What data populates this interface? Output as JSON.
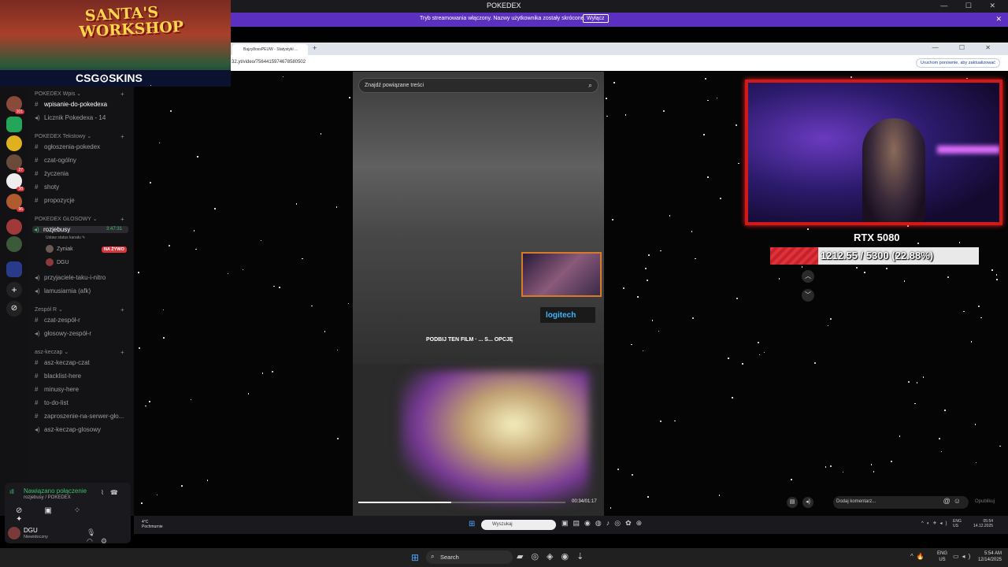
{
  "app": {
    "title": "POKEDEX",
    "window_controls": "— ☐ ✕"
  },
  "stream_notice": {
    "message": "Tryb streamowania włączony. Nazwy użytkownika zostały skrócone.",
    "button": "Wyłącz",
    "close": "✕"
  },
  "banner": {
    "title_line1": "SANTA'S",
    "title_line2": "WORKSHOP",
    "brand": "CSG⊙SKINS"
  },
  "browser": {
    "tab_title": "Bajzy8ossPEUW - Statystyki ...",
    "new_tab": "+",
    "url": "32.yt/video/7564415974678580502",
    "update_button": "Uruchom ponownie, aby zaktualizować"
  },
  "servers": {
    "badges": [
      "101",
      "27",
      "38",
      "96"
    ]
  },
  "channels": {
    "categories": [
      {
        "label": "POKEDEX Wpis ⌄",
        "channels": [
          {
            "label": "wpisanie-do-pokedexa",
            "type": "text",
            "active": true
          },
          {
            "label": "Licznik Pokedexa - 14",
            "type": "voice"
          }
        ]
      },
      {
        "label": "POKEDEX Tekstowy ⌄",
        "channels": [
          {
            "label": "ogłoszenia-pokedex",
            "type": "text"
          },
          {
            "label": "czat-ogólny",
            "type": "text"
          },
          {
            "label": "życzenia",
            "type": "text"
          },
          {
            "label": "shoty",
            "type": "text"
          },
          {
            "label": "propozycje",
            "type": "text"
          }
        ]
      },
      {
        "label": "POKEDEX GŁOSOWY ⌄",
        "channels": [
          {
            "label": "przyjaciele-taku-i-nitro",
            "type": "voice"
          },
          {
            "label": "lamusiarnia (afk)",
            "type": "voice"
          }
        ]
      },
      {
        "label": "Zespół R ⌄",
        "channels": [
          {
            "label": "czat-zespół-r",
            "type": "text"
          },
          {
            "label": "głosowy-zespół-r",
            "type": "voice"
          }
        ]
      },
      {
        "label": "asz-keczap ⌄",
        "channels": [
          {
            "label": "asz-keczap-czat",
            "type": "text"
          },
          {
            "label": "blacklist-here",
            "type": "text"
          },
          {
            "label": "minusy-here",
            "type": "text"
          },
          {
            "label": "to-do-list",
            "type": "text"
          },
          {
            "label": "zaproszenie-na-serwer-gło...",
            "type": "text"
          },
          {
            "label": "asz-keczap-glosowy",
            "type": "voice"
          }
        ]
      }
    ],
    "active_voice": {
      "label": "rozjebusy",
      "timer": "3:47:31",
      "status_hint": "Ustaw status kanału ✎",
      "users": [
        "Zyniak",
        "DGU"
      ],
      "live_badge": "NA ŻYWO"
    }
  },
  "voice_panel": {
    "connected": "Nawiązano połączenie",
    "channel_path": "rozjebusy / POKEDEX",
    "username": "DGU",
    "status": "Niewidoczny"
  },
  "player": {
    "search_placeholder": "Znajdź powiązane treści",
    "caption": "PODBIJ TEN FILM · ... S... OPCJĘ",
    "logitech": "logitech",
    "progress": 0.45,
    "time": "00:34/01:17"
  },
  "overlay": {
    "gpu_title": "RTX 5080",
    "gpu_progress_text": "1212.55 / 5300 (22.88%)",
    "gpu_progress": 0.2288,
    "comment_placeholder": "Dodaj komentarz...",
    "publish": "Opublikuj"
  },
  "inner_taskbar": {
    "temp": "4°C",
    "weather": "Pochmurnie",
    "search": "Wyszukaj",
    "lang1": "ENG",
    "lang2": "US",
    "time": "05:54",
    "date": "14.12.2025"
  },
  "outer_taskbar": {
    "search": "Search",
    "lang1": "ENG",
    "lang2": "US",
    "time": "5:54 AM",
    "date": "12/14/2025"
  },
  "colors": {
    "stream_bar": "#5b2fbf",
    "live_red": "#da373c",
    "connected_green": "#3fbf6a",
    "webcam_border": "#d01a1a"
  }
}
